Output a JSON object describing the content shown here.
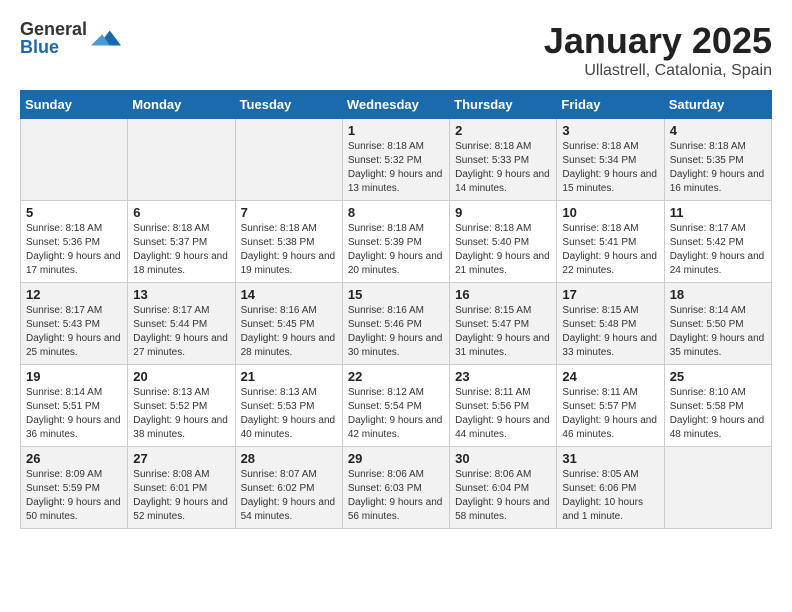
{
  "logo": {
    "general": "General",
    "blue": "Blue"
  },
  "title": "January 2025",
  "location": "Ullastrell, Catalonia, Spain",
  "days_of_week": [
    "Sunday",
    "Monday",
    "Tuesday",
    "Wednesday",
    "Thursday",
    "Friday",
    "Saturday"
  ],
  "weeks": [
    [
      {
        "day": "",
        "info": ""
      },
      {
        "day": "",
        "info": ""
      },
      {
        "day": "",
        "info": ""
      },
      {
        "day": "1",
        "info": "Sunrise: 8:18 AM\nSunset: 5:32 PM\nDaylight: 9 hours\nand 13 minutes."
      },
      {
        "day": "2",
        "info": "Sunrise: 8:18 AM\nSunset: 5:33 PM\nDaylight: 9 hours\nand 14 minutes."
      },
      {
        "day": "3",
        "info": "Sunrise: 8:18 AM\nSunset: 5:34 PM\nDaylight: 9 hours\nand 15 minutes."
      },
      {
        "day": "4",
        "info": "Sunrise: 8:18 AM\nSunset: 5:35 PM\nDaylight: 9 hours\nand 16 minutes."
      }
    ],
    [
      {
        "day": "5",
        "info": "Sunrise: 8:18 AM\nSunset: 5:36 PM\nDaylight: 9 hours\nand 17 minutes."
      },
      {
        "day": "6",
        "info": "Sunrise: 8:18 AM\nSunset: 5:37 PM\nDaylight: 9 hours\nand 18 minutes."
      },
      {
        "day": "7",
        "info": "Sunrise: 8:18 AM\nSunset: 5:38 PM\nDaylight: 9 hours\nand 19 minutes."
      },
      {
        "day": "8",
        "info": "Sunrise: 8:18 AM\nSunset: 5:39 PM\nDaylight: 9 hours\nand 20 minutes."
      },
      {
        "day": "9",
        "info": "Sunrise: 8:18 AM\nSunset: 5:40 PM\nDaylight: 9 hours\nand 21 minutes."
      },
      {
        "day": "10",
        "info": "Sunrise: 8:18 AM\nSunset: 5:41 PM\nDaylight: 9 hours\nand 22 minutes."
      },
      {
        "day": "11",
        "info": "Sunrise: 8:17 AM\nSunset: 5:42 PM\nDaylight: 9 hours\nand 24 minutes."
      }
    ],
    [
      {
        "day": "12",
        "info": "Sunrise: 8:17 AM\nSunset: 5:43 PM\nDaylight: 9 hours\nand 25 minutes."
      },
      {
        "day": "13",
        "info": "Sunrise: 8:17 AM\nSunset: 5:44 PM\nDaylight: 9 hours\nand 27 minutes."
      },
      {
        "day": "14",
        "info": "Sunrise: 8:16 AM\nSunset: 5:45 PM\nDaylight: 9 hours\nand 28 minutes."
      },
      {
        "day": "15",
        "info": "Sunrise: 8:16 AM\nSunset: 5:46 PM\nDaylight: 9 hours\nand 30 minutes."
      },
      {
        "day": "16",
        "info": "Sunrise: 8:15 AM\nSunset: 5:47 PM\nDaylight: 9 hours\nand 31 minutes."
      },
      {
        "day": "17",
        "info": "Sunrise: 8:15 AM\nSunset: 5:48 PM\nDaylight: 9 hours\nand 33 minutes."
      },
      {
        "day": "18",
        "info": "Sunrise: 8:14 AM\nSunset: 5:50 PM\nDaylight: 9 hours\nand 35 minutes."
      }
    ],
    [
      {
        "day": "19",
        "info": "Sunrise: 8:14 AM\nSunset: 5:51 PM\nDaylight: 9 hours\nand 36 minutes."
      },
      {
        "day": "20",
        "info": "Sunrise: 8:13 AM\nSunset: 5:52 PM\nDaylight: 9 hours\nand 38 minutes."
      },
      {
        "day": "21",
        "info": "Sunrise: 8:13 AM\nSunset: 5:53 PM\nDaylight: 9 hours\nand 40 minutes."
      },
      {
        "day": "22",
        "info": "Sunrise: 8:12 AM\nSunset: 5:54 PM\nDaylight: 9 hours\nand 42 minutes."
      },
      {
        "day": "23",
        "info": "Sunrise: 8:11 AM\nSunset: 5:56 PM\nDaylight: 9 hours\nand 44 minutes."
      },
      {
        "day": "24",
        "info": "Sunrise: 8:11 AM\nSunset: 5:57 PM\nDaylight: 9 hours\nand 46 minutes."
      },
      {
        "day": "25",
        "info": "Sunrise: 8:10 AM\nSunset: 5:58 PM\nDaylight: 9 hours\nand 48 minutes."
      }
    ],
    [
      {
        "day": "26",
        "info": "Sunrise: 8:09 AM\nSunset: 5:59 PM\nDaylight: 9 hours\nand 50 minutes."
      },
      {
        "day": "27",
        "info": "Sunrise: 8:08 AM\nSunset: 6:01 PM\nDaylight: 9 hours\nand 52 minutes."
      },
      {
        "day": "28",
        "info": "Sunrise: 8:07 AM\nSunset: 6:02 PM\nDaylight: 9 hours\nand 54 minutes."
      },
      {
        "day": "29",
        "info": "Sunrise: 8:06 AM\nSunset: 6:03 PM\nDaylight: 9 hours\nand 56 minutes."
      },
      {
        "day": "30",
        "info": "Sunrise: 8:06 AM\nSunset: 6:04 PM\nDaylight: 9 hours\nand 58 minutes."
      },
      {
        "day": "31",
        "info": "Sunrise: 8:05 AM\nSunset: 6:06 PM\nDaylight: 10 hours\nand 1 minute."
      },
      {
        "day": "",
        "info": ""
      }
    ]
  ]
}
